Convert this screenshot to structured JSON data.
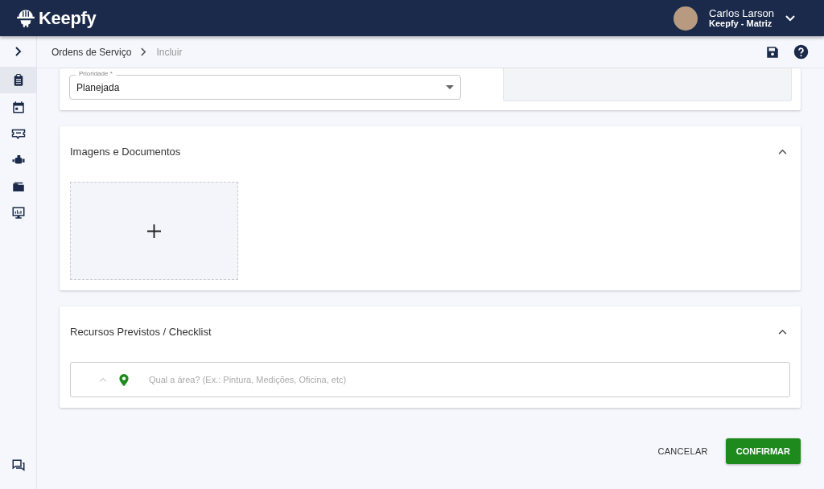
{
  "header": {
    "brand": "Keepfy",
    "user": {
      "name": "Carlos Larson",
      "company": "Keepfy - Matriz"
    }
  },
  "sidebar": {
    "items": [
      {
        "kind": "clipboard",
        "selected": true
      },
      {
        "kind": "calendar",
        "selected": false
      },
      {
        "kind": "ticket",
        "selected": false
      },
      {
        "kind": "engine",
        "selected": false
      },
      {
        "kind": "folder",
        "selected": false
      },
      {
        "kind": "monitor",
        "selected": false
      }
    ]
  },
  "breadcrumb": [
    "Ordens de Serviço",
    "Incluir"
  ],
  "priority_field": {
    "label": "Prioridade *",
    "value": "Planejada"
  },
  "sections": [
    {
      "title": "Imagens e Documentos",
      "expanded": true,
      "kind": "upload"
    },
    {
      "title": "Recursos Previstos / Checklist",
      "expanded": true,
      "kind": "area",
      "placeholder": "Qual a área? (Ex.: Pintura, Medições, Oficina, etc)"
    }
  ],
  "buttons": {
    "cancel": "CANCELAR",
    "confirm": "CONFIRMAR"
  }
}
